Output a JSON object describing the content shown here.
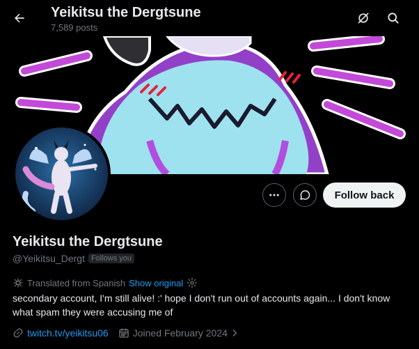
{
  "header": {
    "title": "Yeikitsu the Dergtsune",
    "posts": "7,589 posts",
    "back_icon": "arrow-left-icon",
    "grok_icon": "grok-icon",
    "search_icon": "search-icon"
  },
  "profile": {
    "display_name": "Yeikitsu the Dergtsune",
    "handle": "@Yeikitsu_Dergt",
    "follows_you": "Follows you",
    "translated_from": "Translated from Spanish",
    "show_original": "Show original",
    "bio": "secondary account, I'm still alive! :' hope I don't run out of accounts again... I don't know what spam they were accusing me of",
    "website": "twitch.tv/yeikitsu06",
    "joined": "Joined February 2024"
  },
  "actions": {
    "follow_back": "Follow back",
    "more_icon": "more-icon",
    "message_icon": "message-icon"
  },
  "colors": {
    "accent": "#1d9bf0",
    "background": "#000000",
    "text": "#e7e9ea",
    "muted": "#71767b"
  }
}
